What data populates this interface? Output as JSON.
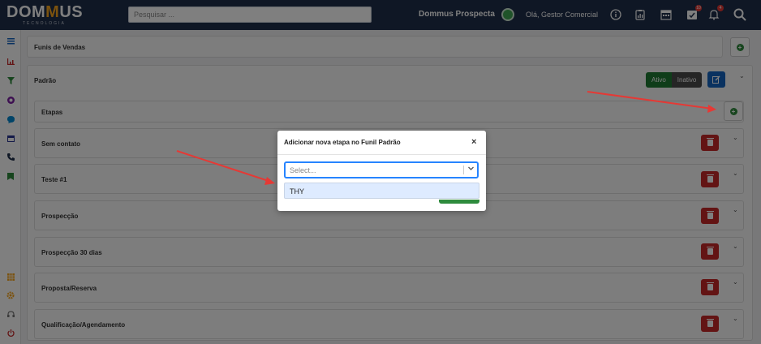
{
  "header": {
    "logo_main": "DOM",
    "logo_m": "M",
    "logo_rest": "US",
    "logo_sub": "TECNOLOGIA",
    "search_placeholder": "Pesquisar ...",
    "brand": "Dommus Prospecta",
    "greeting": "Olá, Gestor Comercial",
    "icons": [
      "info-icon",
      "clipboard-icon",
      "calendar-icon",
      "tasks-icon",
      "bell-icon",
      "search-icon"
    ],
    "badges": {
      "tasks": "10",
      "notifications": "4"
    }
  },
  "sidebar": {
    "icons": [
      "menu-icon",
      "chart-icon",
      "filter-icon",
      "target-icon",
      "chat-icon",
      "calendar-icon",
      "phone-icon",
      "bookmark-icon",
      "grid-icon",
      "gear-icon",
      "headset-icon",
      "power-icon"
    ]
  },
  "main": {
    "funnels_title": "Funis de Vendas",
    "funnel_name": "Padrão",
    "toggle_active": "Ativo",
    "toggle_inactive": "Inativo",
    "stages_title": "Etapas",
    "stages": [
      "Sem contato",
      "Teste #1",
      "Prospecção",
      "Prospecção 30 dias",
      "Proposta/Reserva",
      "Qualificação/Agendamento"
    ]
  },
  "modal": {
    "title": "Adicionar nova etapa no Funil Padrão",
    "close": "×",
    "select_placeholder": "Select...",
    "options": [
      "THY"
    ]
  },
  "colors": {
    "topbar": "#1f2e4a",
    "accent_orange": "#f7a51c",
    "danger": "#c62828",
    "success": "#1f7a33",
    "primary": "#1565c0",
    "annotation_arrow": "#e53935"
  }
}
